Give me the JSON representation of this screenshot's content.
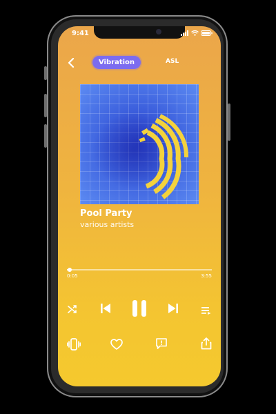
{
  "status": {
    "time": "9:41"
  },
  "header": {
    "tabs": [
      {
        "label": "Vibration",
        "active": true
      },
      {
        "label": "ASL",
        "active": false
      }
    ]
  },
  "track": {
    "title": "Pool Party",
    "artist": "various artists",
    "elapsed": "0:05",
    "duration": "3:55",
    "progress_fraction": 0.02
  },
  "colors": {
    "accent": "#7c6cf0",
    "background_top": "#eba64a",
    "background_bottom": "#f5c92e",
    "art_blue": "#3e62de",
    "art_yellow": "#f4d23c"
  },
  "icons": {
    "shuffle": "shuffle-icon",
    "previous": "skip-previous-icon",
    "pause": "pause-icon",
    "next": "skip-next-icon",
    "queue": "queue-icon",
    "vibrate": "vibrate-icon",
    "like": "heart-icon",
    "lyrics": "lyrics-icon",
    "share": "share-icon"
  }
}
